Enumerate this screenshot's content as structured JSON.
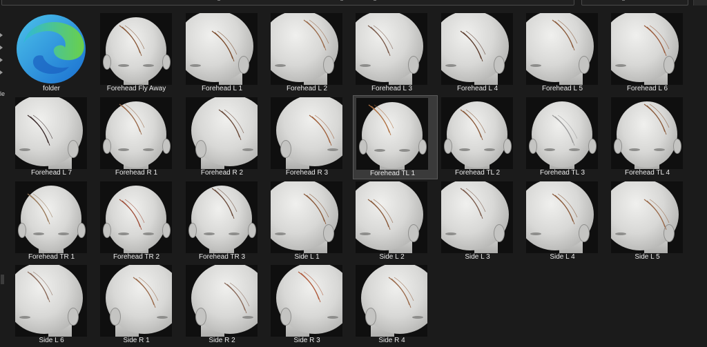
{
  "side_panel": {
    "partial_label": "le"
  },
  "items": [
    {
      "label": "folder",
      "kind": "folder"
    },
    {
      "label": "Forehead Fly Away",
      "kind": "front",
      "hair": "#8a5a3a"
    },
    {
      "label": "Forehead L 1",
      "kind": "angle",
      "hair": "#7a4a2a"
    },
    {
      "label": "Forehead L 2",
      "kind": "angle",
      "hair": "#9a6a4a"
    },
    {
      "label": "Forehead L 3",
      "kind": "angle",
      "hair": "#7a5a4a"
    },
    {
      "label": "Forehead L 4",
      "kind": "angle",
      "hair": "#5a3a2a"
    },
    {
      "label": "Forehead L 5",
      "kind": "angle",
      "hair": "#8a5a3a"
    },
    {
      "label": "Forehead L 6",
      "kind": "angle",
      "hair": "#9a5a3a"
    },
    {
      "label": "Forehead L 7",
      "kind": "angle",
      "hair": "#3a2a2a"
    },
    {
      "label": "Forehead R 1",
      "kind": "front",
      "hair": "#9a6a4a"
    },
    {
      "label": "Forehead R 2",
      "kind": "angle-r",
      "hair": "#6a4a3a"
    },
    {
      "label": "Forehead R 3",
      "kind": "angle-r",
      "hair": "#a0603a"
    },
    {
      "label": "Forehead TL 1",
      "kind": "front",
      "hair": "#b07040",
      "selected": true
    },
    {
      "label": "Forehead TL 2",
      "kind": "front",
      "hair": "#8a5a3a"
    },
    {
      "label": "Forehead TL 3",
      "kind": "front",
      "hair": "#9a9a9a"
    },
    {
      "label": "Forehead TL 4",
      "kind": "front",
      "hair": "#8a5a3a"
    },
    {
      "label": "Forehead TR 1",
      "kind": "front",
      "hair": "#9a7a5a"
    },
    {
      "label": "Forehead TR 2",
      "kind": "front",
      "hair": "#a0503a"
    },
    {
      "label": "Forehead TR 3",
      "kind": "front",
      "hair": "#6a4a3a"
    },
    {
      "label": "Side L 1",
      "kind": "angle",
      "hair": "#8a5a3a"
    },
    {
      "label": "Side L 2",
      "kind": "angle",
      "hair": "#8a5a3a"
    },
    {
      "label": "Side L 3",
      "kind": "angle",
      "hair": "#7a5a4a"
    },
    {
      "label": "Side L 4",
      "kind": "angle",
      "hair": "#8a5a3a"
    },
    {
      "label": "Side L 5",
      "kind": "angle",
      "hair": "#9a6a4a"
    },
    {
      "label": "Side L 6",
      "kind": "angle",
      "hair": "#8a6a5a"
    },
    {
      "label": "Side R 1",
      "kind": "angle-r",
      "hair": "#9a6a4a"
    },
    {
      "label": "Side R 2",
      "kind": "angle-r",
      "hair": "#8a6a5a"
    },
    {
      "label": "Side R 3",
      "kind": "angle-r",
      "hair": "#b05a3a"
    },
    {
      "label": "Side R 4",
      "kind": "angle-r",
      "hair": "#9a6a4a"
    }
  ]
}
